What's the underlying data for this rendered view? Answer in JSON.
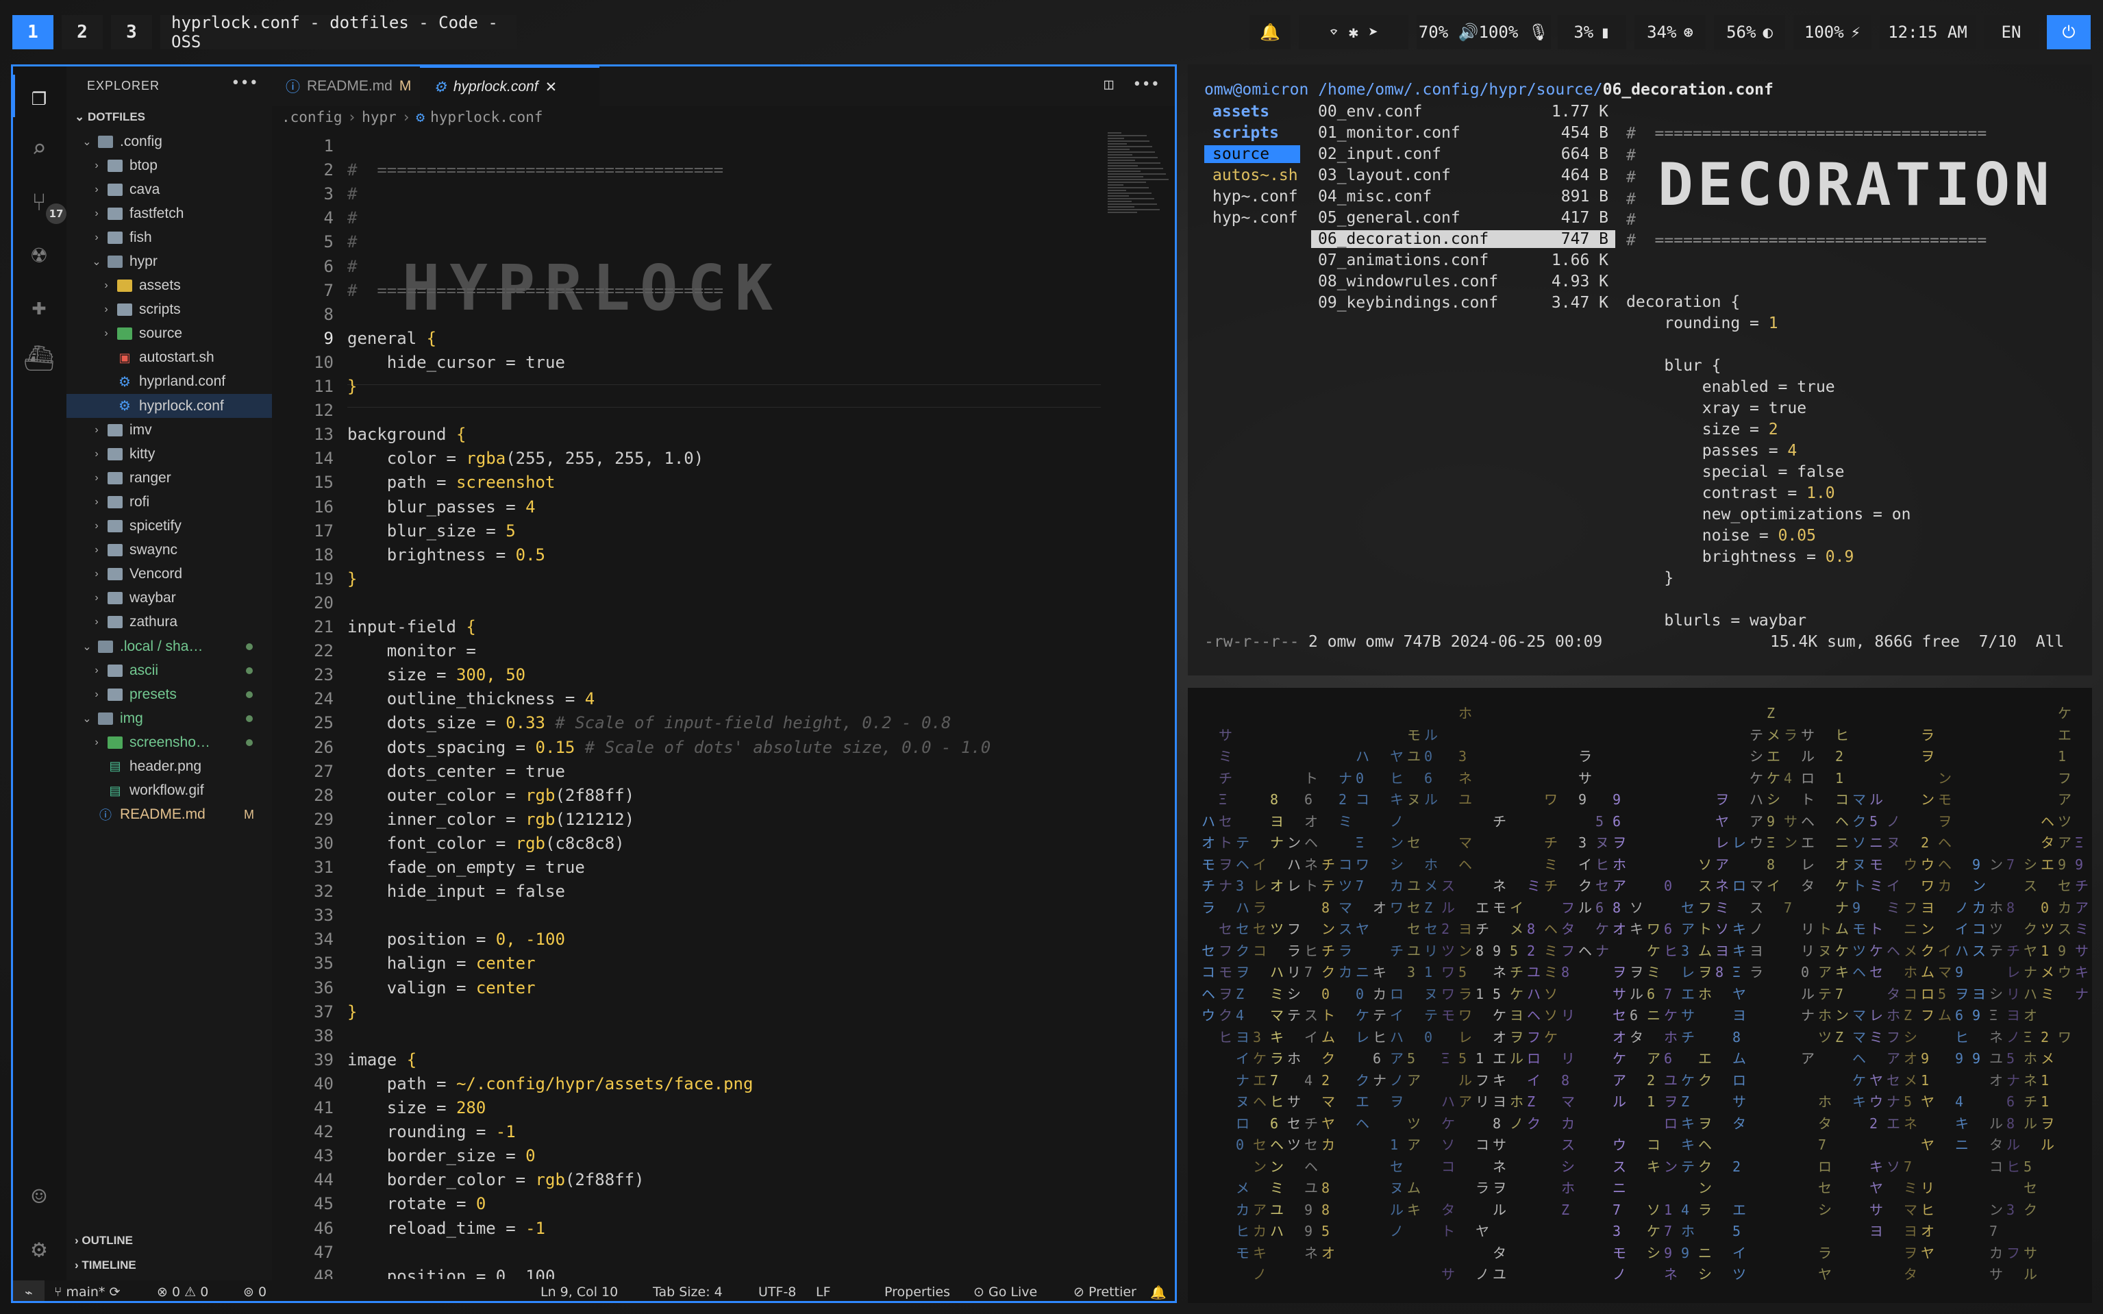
{
  "topbar": {
    "workspaces": [
      "1",
      "2",
      "3"
    ],
    "window_title": "hyprlock.conf - dotfiles - Code - OSS",
    "network_icons": "⌔ ✱ ➤",
    "volume": "70% 🔊100% 🎙",
    "cpu": "3%",
    "ram": "34%",
    "brightness": "56%",
    "battery": "100%",
    "clock": "12:15 AM",
    "lang": "EN"
  },
  "vscode": {
    "explorer_title": "EXPLORER",
    "section": "DOTFILES",
    "scm_badge": "17",
    "tree": [
      {
        "indent": 1,
        "type": "folder-open",
        "chev": "⌄",
        "label": ".config"
      },
      {
        "indent": 2,
        "type": "folder",
        "chev": "›",
        "label": "btop"
      },
      {
        "indent": 2,
        "type": "folder",
        "chev": "›",
        "label": "cava"
      },
      {
        "indent": 2,
        "type": "folder",
        "chev": "›",
        "label": "fastfetch"
      },
      {
        "indent": 2,
        "type": "folder",
        "chev": "›",
        "label": "fish"
      },
      {
        "indent": 2,
        "type": "folder-open",
        "chev": "⌄",
        "label": "hypr"
      },
      {
        "indent": 3,
        "type": "folder-yellow",
        "chev": "›",
        "label": "assets"
      },
      {
        "indent": 3,
        "type": "folder",
        "chev": "›",
        "label": "scripts"
      },
      {
        "indent": 3,
        "type": "folder-green",
        "chev": "›",
        "label": "source"
      },
      {
        "indent": 3,
        "type": "sh",
        "chev": "",
        "label": "autostart.sh"
      },
      {
        "indent": 3,
        "type": "gear",
        "chev": "",
        "label": "hyprland.conf"
      },
      {
        "indent": 3,
        "type": "gear",
        "chev": "",
        "label": "hyprlock.conf",
        "selected": true
      },
      {
        "indent": 2,
        "type": "folder",
        "chev": "›",
        "label": "imv"
      },
      {
        "indent": 2,
        "type": "folder",
        "chev": "›",
        "label": "kitty"
      },
      {
        "indent": 2,
        "type": "folder",
        "chev": "›",
        "label": "ranger"
      },
      {
        "indent": 2,
        "type": "folder",
        "chev": "›",
        "label": "rofi"
      },
      {
        "indent": 2,
        "type": "folder",
        "chev": "›",
        "label": "spicetify"
      },
      {
        "indent": 2,
        "type": "folder",
        "chev": "›",
        "label": "swaync"
      },
      {
        "indent": 2,
        "type": "folder",
        "chev": "›",
        "label": "Vencord"
      },
      {
        "indent": 2,
        "type": "folder",
        "chev": "›",
        "label": "waybar"
      },
      {
        "indent": 2,
        "type": "folder",
        "chev": "›",
        "label": "zathura"
      },
      {
        "indent": 1,
        "type": "folder-open",
        "chev": "⌄",
        "label": ".local / sha…",
        "green": true,
        "dot": true
      },
      {
        "indent": 2,
        "type": "folder",
        "chev": "›",
        "label": "ascii",
        "green": true,
        "dot": true
      },
      {
        "indent": 2,
        "type": "folder",
        "chev": "›",
        "label": "presets",
        "green": true,
        "dot": true
      },
      {
        "indent": 1,
        "type": "folder-open",
        "chev": "⌄",
        "label": "img",
        "green": true,
        "dot": true
      },
      {
        "indent": 2,
        "type": "folder-green",
        "chev": "›",
        "label": "screensho…",
        "green": true,
        "dot": true
      },
      {
        "indent": 2,
        "type": "img",
        "chev": "",
        "label": "header.png"
      },
      {
        "indent": 2,
        "type": "img",
        "chev": "",
        "label": "workflow.gif"
      },
      {
        "indent": 1,
        "type": "info",
        "chev": "",
        "label": "README.md",
        "mod": true,
        "flag": "M"
      }
    ],
    "outline": "OUTLINE",
    "timeline": "TIMELINE",
    "tab1": "README.md",
    "tab1_flag": "M",
    "tab2": "hyprlock.conf",
    "breadcrumb": [
      ".config",
      "hypr",
      "hyprlock.conf"
    ],
    "ascii_title": "HYPRLOCK",
    "code": [
      [
        {
          "t": ""
        }
      ],
      [
        {
          "t": "#  ===================================",
          "c": "cmt"
        }
      ],
      [
        {
          "t": "#",
          "c": "cmt"
        }
      ],
      [
        {
          "t": "#",
          "c": "cmt"
        }
      ],
      [
        {
          "t": "#",
          "c": "cmt"
        }
      ],
      [
        {
          "t": "#",
          "c": "cmt"
        }
      ],
      [
        {
          "t": "#  ===================================",
          "c": "cmt"
        }
      ],
      [
        {
          "t": ""
        }
      ],
      [
        {
          "t": "general "
        },
        {
          "t": "{",
          "c": "kw"
        }
      ],
      [
        {
          "t": "    hide_cursor = "
        },
        {
          "t": "true"
        }
      ],
      [
        {
          "t": "}",
          "c": "kw"
        }
      ],
      [
        {
          "t": ""
        }
      ],
      [
        {
          "t": "background "
        },
        {
          "t": "{",
          "c": "kw"
        }
      ],
      [
        {
          "t": "    color = "
        },
        {
          "t": "rgba",
          "c": "fn"
        },
        {
          "t": "(255, 255, 255, 1.0)"
        }
      ],
      [
        {
          "t": "    path = "
        },
        {
          "t": "screenshot",
          "c": "fn"
        }
      ],
      [
        {
          "t": "    blur_passes = "
        },
        {
          "t": "4",
          "c": "num"
        }
      ],
      [
        {
          "t": "    blur_size = "
        },
        {
          "t": "5",
          "c": "num"
        }
      ],
      [
        {
          "t": "    brightness = "
        },
        {
          "t": "0.5",
          "c": "num"
        }
      ],
      [
        {
          "t": "}",
          "c": "kw"
        }
      ],
      [
        {
          "t": ""
        }
      ],
      [
        {
          "t": "input-field "
        },
        {
          "t": "{",
          "c": "kw"
        }
      ],
      [
        {
          "t": "    monitor ="
        }
      ],
      [
        {
          "t": "    size = "
        },
        {
          "t": "300, 50",
          "c": "num"
        }
      ],
      [
        {
          "t": "    outline_thickness = "
        },
        {
          "t": "4",
          "c": "num"
        }
      ],
      [
        {
          "t": "    dots_size = "
        },
        {
          "t": "0.33",
          "c": "num"
        },
        {
          "t": " # Scale of input-field height, 0.2 - 0.8",
          "c": "cmtit"
        }
      ],
      [
        {
          "t": "    dots_spacing = "
        },
        {
          "t": "0.15",
          "c": "num"
        },
        {
          "t": " # Scale of dots' absolute size, 0.0 - 1.0",
          "c": "cmtit"
        }
      ],
      [
        {
          "t": "    dots_center = "
        },
        {
          "t": "true"
        }
      ],
      [
        {
          "t": "    outer_color = "
        },
        {
          "t": "rgb",
          "c": "fn"
        },
        {
          "t": "(2f88ff)"
        }
      ],
      [
        {
          "t": "    inner_color = "
        },
        {
          "t": "rgb",
          "c": "fn"
        },
        {
          "t": "(121212)"
        }
      ],
      [
        {
          "t": "    font_color = "
        },
        {
          "t": "rgb",
          "c": "fn"
        },
        {
          "t": "(c8c8c8)"
        }
      ],
      [
        {
          "t": "    fade_on_empty = "
        },
        {
          "t": "true"
        }
      ],
      [
        {
          "t": "    hide_input = "
        },
        {
          "t": "false"
        }
      ],
      [
        {
          "t": ""
        }
      ],
      [
        {
          "t": "    position = "
        },
        {
          "t": "0, -100",
          "c": "num"
        }
      ],
      [
        {
          "t": "    halign = "
        },
        {
          "t": "center",
          "c": "fn"
        }
      ],
      [
        {
          "t": "    valign = "
        },
        {
          "t": "center",
          "c": "fn"
        }
      ],
      [
        {
          "t": "}",
          "c": "kw"
        }
      ],
      [
        {
          "t": ""
        }
      ],
      [
        {
          "t": "image "
        },
        {
          "t": "{",
          "c": "kw"
        }
      ],
      [
        {
          "t": "    path = "
        },
        {
          "t": "~/.config/hypr/assets/face.png",
          "c": "fn"
        }
      ],
      [
        {
          "t": "    size = "
        },
        {
          "t": "280",
          "c": "num"
        }
      ],
      [
        {
          "t": "    rounding = "
        },
        {
          "t": "-1",
          "c": "num"
        }
      ],
      [
        {
          "t": "    border_size = "
        },
        {
          "t": "0",
          "c": "num"
        }
      ],
      [
        {
          "t": "    border_color = "
        },
        {
          "t": "rgb",
          "c": "fn"
        },
        {
          "t": "(2f88ff)"
        }
      ],
      [
        {
          "t": "    rotate = "
        },
        {
          "t": "0",
          "c": "num"
        }
      ],
      [
        {
          "t": "    reload_time = "
        },
        {
          "t": "-1",
          "c": "num"
        }
      ],
      [
        {
          "t": ""
        }
      ],
      [
        {
          "t": "    position = 0, 100"
        }
      ]
    ],
    "status": {
      "branch": "main*",
      "errors": "0",
      "warnings": "0",
      "ports": "0",
      "position": "Ln 9, Col 10",
      "tab_size": "Tab Size: 4",
      "encoding": "UTF-8",
      "eol": "LF",
      "language": "Properties",
      "golive": "Go Live",
      "prettier": "Prettier"
    }
  },
  "ranger": {
    "user": "omw@omicron",
    "path_dim": "/home/omw/.config/hypr/source/",
    "path_file": "06_decoration.conf",
    "parent": [
      "assets",
      "scripts",
      "source",
      "autos~.sh",
      "hyp~.conf",
      "hyp~.conf"
    ],
    "files": [
      {
        "name": "00_env.conf",
        "size": "1.77 K"
      },
      {
        "name": "01_monitor.conf",
        "size": "454 B"
      },
      {
        "name": "02_input.conf",
        "size": "664 B"
      },
      {
        "name": "03_layout.conf",
        "size": "464 B"
      },
      {
        "name": "04_misc.conf",
        "size": "891 B"
      },
      {
        "name": "05_general.conf",
        "size": "417 B"
      },
      {
        "name": "06_decoration.conf",
        "size": "747 B"
      },
      {
        "name": "07_animations.conf",
        "size": "1.66 K"
      },
      {
        "name": "08_windowrules.conf",
        "size": "4.93 K"
      },
      {
        "name": "09_keybindings.conf",
        "size": "3.47 K"
      }
    ],
    "preview_rule": "#  ===================================",
    "preview_hash": "#",
    "ascii_title": "DECORATION",
    "preview": [
      [
        {
          "t": "decoration {"
        }
      ],
      [
        {
          "t": "    rounding = "
        },
        {
          "t": "1",
          "c": "yellow"
        }
      ],
      [
        {
          "t": ""
        }
      ],
      [
        {
          "t": "    blur {"
        }
      ],
      [
        {
          "t": "        enabled = true"
        }
      ],
      [
        {
          "t": "        xray = true"
        }
      ],
      [
        {
          "t": "        size = "
        },
        {
          "t": "2",
          "c": "yellow"
        }
      ],
      [
        {
          "t": "        passes = "
        },
        {
          "t": "4",
          "c": "yellow"
        }
      ],
      [
        {
          "t": "        special = false"
        }
      ],
      [
        {
          "t": "        contrast = "
        },
        {
          "t": "1.0",
          "c": "yellow"
        }
      ],
      [
        {
          "t": "        new_optimizations = on"
        }
      ],
      [
        {
          "t": "        noise = "
        },
        {
          "t": "0.05",
          "c": "yellow"
        }
      ],
      [
        {
          "t": "        brightness = "
        },
        {
          "t": "0.9",
          "c": "yellow"
        }
      ],
      [
        {
          "t": "    }"
        }
      ],
      [
        {
          "t": ""
        }
      ],
      [
        {
          "t": "    blurls = waybar"
        }
      ]
    ],
    "status_perm": "-rw-r--r--",
    "status_info": "2 omw omw 747B 2024-06-25 00:09",
    "status_right": "15.4K sum, 866G free  7/10  All"
  },
  "matrix": {
    "glyphs": "アイウエオカキクケコサシスセソタチツテトナニヌネノハヒフヘホマミムメモヤユヨラリルレロワヲン1234567890ZΞ",
    "colors": [
      "#c8b25a",
      "#8a6fc8",
      "#5a8fd0",
      "#b8b8b8",
      "#c8c070",
      "#9a84d4"
    ]
  }
}
